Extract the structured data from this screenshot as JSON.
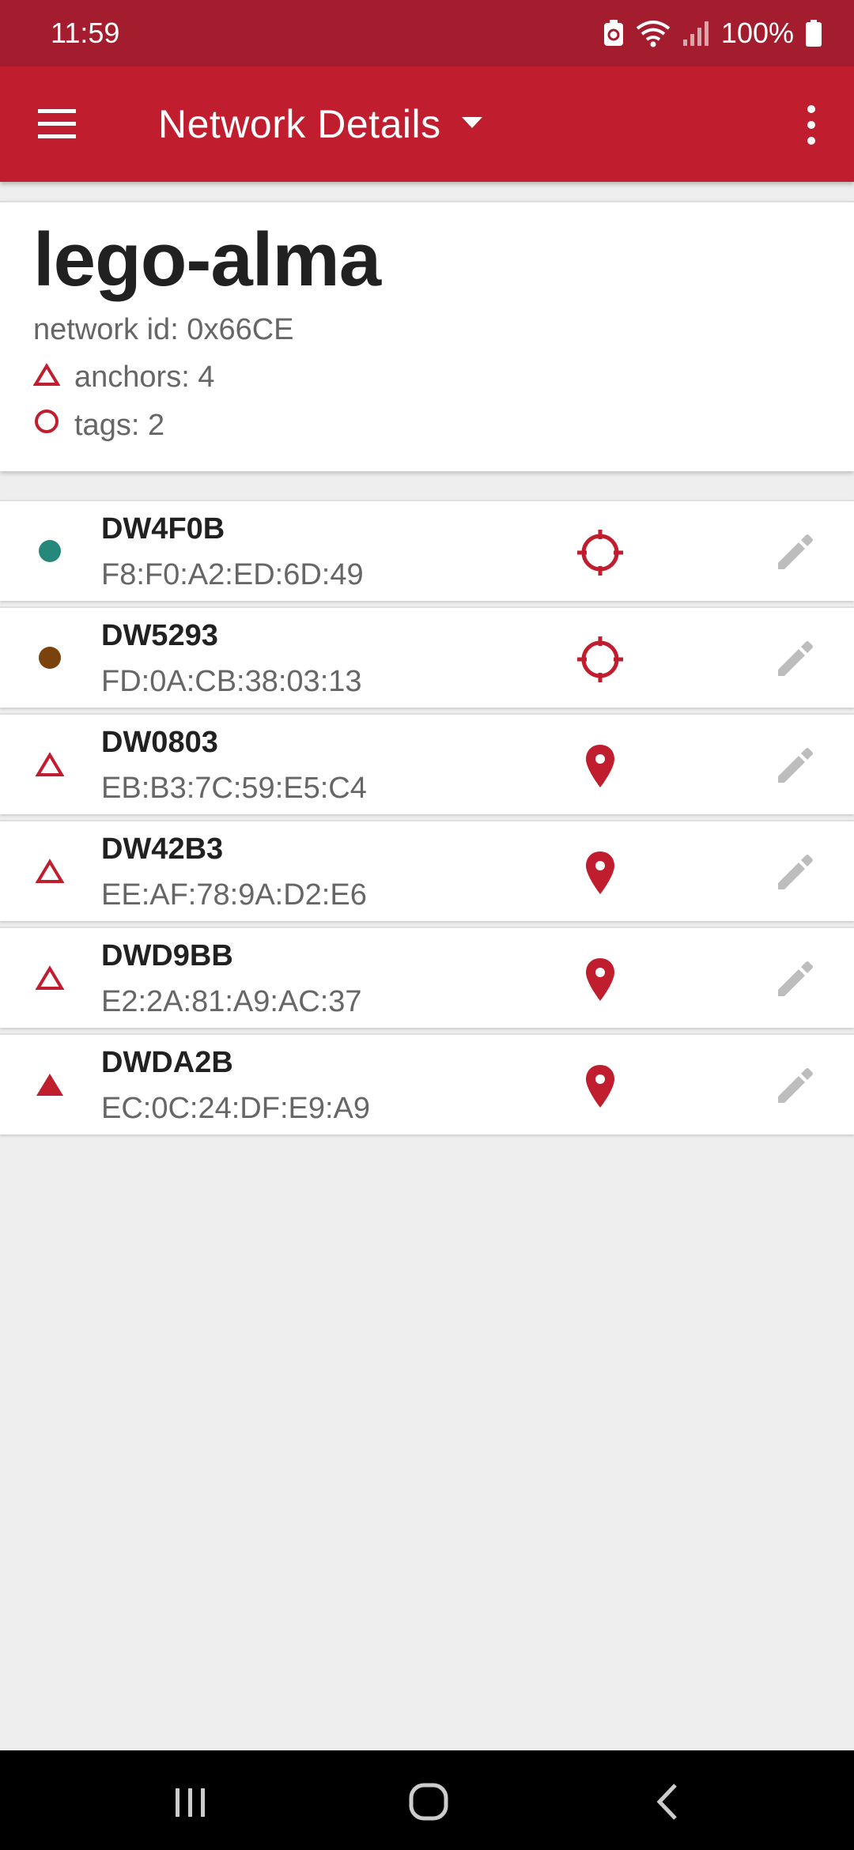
{
  "status": {
    "time": "11:59",
    "battery": "100%"
  },
  "appbar": {
    "title": "Network Details"
  },
  "network": {
    "name": "lego-alma",
    "id_label": "network id: 0x66CE",
    "anchors_label": "anchors: 4",
    "tags_label": "tags: 2"
  },
  "colors": {
    "brand": "#c01e2e",
    "status_bar": "#a31d2e",
    "tag_teal": "#26877b",
    "tag_brown": "#7a420c"
  },
  "devices": [
    {
      "name": "DW4F0B",
      "mac": "F8:F0:A2:ED:6D:49",
      "kind": "tag",
      "marker_icon": "teal-dot-icon",
      "action_icon": "crosshair-icon"
    },
    {
      "name": "DW5293",
      "mac": "FD:0A:CB:38:03:13",
      "kind": "tag",
      "marker_icon": "brown-dot-icon",
      "action_icon": "crosshair-icon"
    },
    {
      "name": "DW0803",
      "mac": "EB:B3:7C:59:E5:C4",
      "kind": "anchor",
      "marker_icon": "triangle-outline-icon",
      "action_icon": "location-pin-icon"
    },
    {
      "name": "DW42B3",
      "mac": "EE:AF:78:9A:D2:E6",
      "kind": "anchor",
      "marker_icon": "triangle-outline-icon",
      "action_icon": "location-pin-icon"
    },
    {
      "name": "DWD9BB",
      "mac": "E2:2A:81:A9:AC:37",
      "kind": "anchor",
      "marker_icon": "triangle-outline-icon",
      "action_icon": "location-pin-icon"
    },
    {
      "name": "DWDA2B",
      "mac": "EC:0C:24:DF:E9:A9",
      "kind": "anchor",
      "marker_icon": "triangle-filled-icon",
      "action_icon": "location-pin-icon"
    }
  ]
}
